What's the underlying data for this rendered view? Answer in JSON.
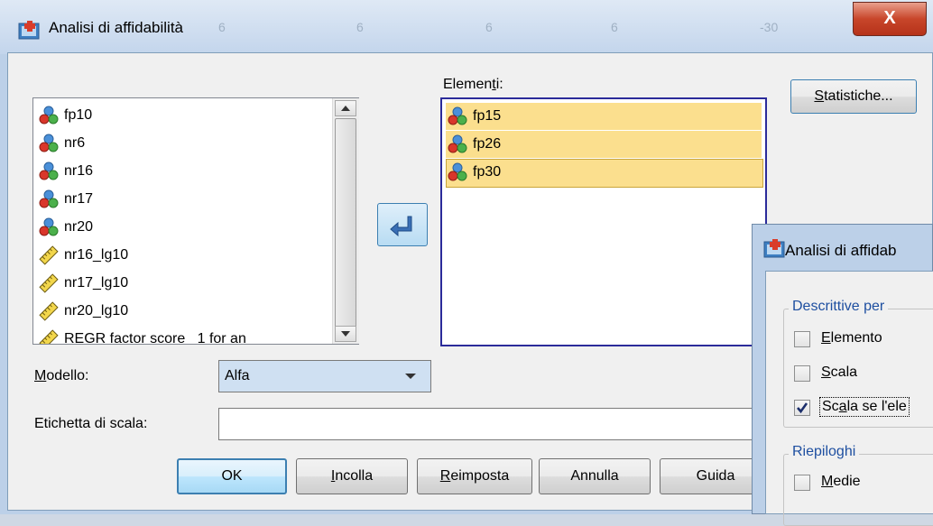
{
  "window": {
    "title": "Analisi di affidabilità",
    "close_label": "X",
    "background_ghost": [
      "6",
      "6",
      "6",
      "6",
      "-30"
    ]
  },
  "source_list": {
    "items": [
      {
        "label": "fp10",
        "icon": "nominal-variable-icon"
      },
      {
        "label": "nr6",
        "icon": "nominal-variable-icon"
      },
      {
        "label": "nr16",
        "icon": "nominal-variable-icon"
      },
      {
        "label": "nr17",
        "icon": "nominal-variable-icon"
      },
      {
        "label": "nr20",
        "icon": "nominal-variable-icon"
      },
      {
        "label": "nr16_lg10",
        "icon": "scale-variable-icon"
      },
      {
        "label": "nr17_lg10",
        "icon": "scale-variable-icon"
      },
      {
        "label": "nr20_lg10",
        "icon": "scale-variable-icon"
      },
      {
        "label": "REGR factor score   1 for an",
        "icon": "scale-variable-icon"
      }
    ]
  },
  "elementi": {
    "label_pre": "Elemen",
    "label_accel": "t",
    "label_post": "i:",
    "items": [
      {
        "label": "fp15",
        "icon": "nominal-variable-icon"
      },
      {
        "label": "fp26",
        "icon": "nominal-variable-icon"
      },
      {
        "label": "fp30",
        "icon": "nominal-variable-icon"
      }
    ]
  },
  "buttons": {
    "statistiche_accel": "S",
    "statistiche_rest": "tatistiche...",
    "ok": "OK",
    "incolla_accel": "I",
    "incolla_rest": "ncolla",
    "reimposta_accel": "R",
    "reimposta_rest": "eimposta",
    "annulla": "Annulla",
    "guida": "Guida"
  },
  "modello": {
    "label_accel": "M",
    "label_rest": "odello:",
    "value": "Alfa"
  },
  "etichetta": {
    "label": "Etichetta di scala:",
    "value": ""
  },
  "statistics_dialog": {
    "title": "Analisi di affidab",
    "group1_legend": "Descrittive per",
    "elemento_accel": "E",
    "elemento_rest": "lemento",
    "elemento_checked": false,
    "scala_accel": "S",
    "scala_rest": "cala",
    "scala_checked": false,
    "scala_se_pre": "Sc",
    "scala_se_accel": "a",
    "scala_se_rest": "la se l'ele",
    "scala_se_checked": true,
    "group2_legend": "Riepiloghi",
    "medie_accel": "M",
    "medie_rest": "edie",
    "medie_checked": false
  }
}
